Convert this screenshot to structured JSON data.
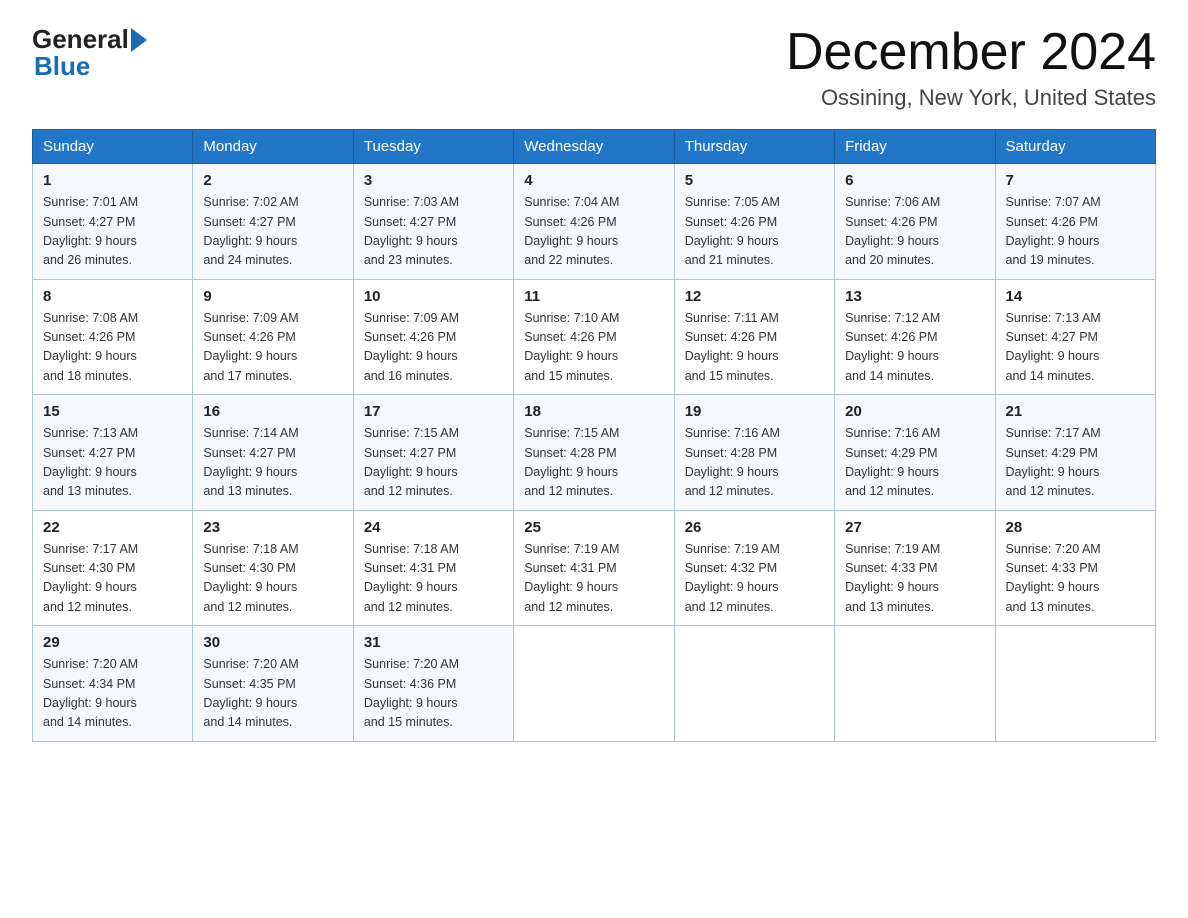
{
  "logo": {
    "general": "General",
    "blue": "Blue",
    "arrow": "▶"
  },
  "title": {
    "month": "December 2024",
    "location": "Ossining, New York, United States"
  },
  "days_of_week": [
    "Sunday",
    "Monday",
    "Tuesday",
    "Wednesday",
    "Thursday",
    "Friday",
    "Saturday"
  ],
  "weeks": [
    [
      {
        "day": "1",
        "sunrise": "7:01 AM",
        "sunset": "4:27 PM",
        "daylight": "9 hours and 26 minutes."
      },
      {
        "day": "2",
        "sunrise": "7:02 AM",
        "sunset": "4:27 PM",
        "daylight": "9 hours and 24 minutes."
      },
      {
        "day": "3",
        "sunrise": "7:03 AM",
        "sunset": "4:27 PM",
        "daylight": "9 hours and 23 minutes."
      },
      {
        "day": "4",
        "sunrise": "7:04 AM",
        "sunset": "4:26 PM",
        "daylight": "9 hours and 22 minutes."
      },
      {
        "day": "5",
        "sunrise": "7:05 AM",
        "sunset": "4:26 PM",
        "daylight": "9 hours and 21 minutes."
      },
      {
        "day": "6",
        "sunrise": "7:06 AM",
        "sunset": "4:26 PM",
        "daylight": "9 hours and 20 minutes."
      },
      {
        "day": "7",
        "sunrise": "7:07 AM",
        "sunset": "4:26 PM",
        "daylight": "9 hours and 19 minutes."
      }
    ],
    [
      {
        "day": "8",
        "sunrise": "7:08 AM",
        "sunset": "4:26 PM",
        "daylight": "9 hours and 18 minutes."
      },
      {
        "day": "9",
        "sunrise": "7:09 AM",
        "sunset": "4:26 PM",
        "daylight": "9 hours and 17 minutes."
      },
      {
        "day": "10",
        "sunrise": "7:09 AM",
        "sunset": "4:26 PM",
        "daylight": "9 hours and 16 minutes."
      },
      {
        "day": "11",
        "sunrise": "7:10 AM",
        "sunset": "4:26 PM",
        "daylight": "9 hours and 15 minutes."
      },
      {
        "day": "12",
        "sunrise": "7:11 AM",
        "sunset": "4:26 PM",
        "daylight": "9 hours and 15 minutes."
      },
      {
        "day": "13",
        "sunrise": "7:12 AM",
        "sunset": "4:26 PM",
        "daylight": "9 hours and 14 minutes."
      },
      {
        "day": "14",
        "sunrise": "7:13 AM",
        "sunset": "4:27 PM",
        "daylight": "9 hours and 14 minutes."
      }
    ],
    [
      {
        "day": "15",
        "sunrise": "7:13 AM",
        "sunset": "4:27 PM",
        "daylight": "9 hours and 13 minutes."
      },
      {
        "day": "16",
        "sunrise": "7:14 AM",
        "sunset": "4:27 PM",
        "daylight": "9 hours and 13 minutes."
      },
      {
        "day": "17",
        "sunrise": "7:15 AM",
        "sunset": "4:27 PM",
        "daylight": "9 hours and 12 minutes."
      },
      {
        "day": "18",
        "sunrise": "7:15 AM",
        "sunset": "4:28 PM",
        "daylight": "9 hours and 12 minutes."
      },
      {
        "day": "19",
        "sunrise": "7:16 AM",
        "sunset": "4:28 PM",
        "daylight": "9 hours and 12 minutes."
      },
      {
        "day": "20",
        "sunrise": "7:16 AM",
        "sunset": "4:29 PM",
        "daylight": "9 hours and 12 minutes."
      },
      {
        "day": "21",
        "sunrise": "7:17 AM",
        "sunset": "4:29 PM",
        "daylight": "9 hours and 12 minutes."
      }
    ],
    [
      {
        "day": "22",
        "sunrise": "7:17 AM",
        "sunset": "4:30 PM",
        "daylight": "9 hours and 12 minutes."
      },
      {
        "day": "23",
        "sunrise": "7:18 AM",
        "sunset": "4:30 PM",
        "daylight": "9 hours and 12 minutes."
      },
      {
        "day": "24",
        "sunrise": "7:18 AM",
        "sunset": "4:31 PM",
        "daylight": "9 hours and 12 minutes."
      },
      {
        "day": "25",
        "sunrise": "7:19 AM",
        "sunset": "4:31 PM",
        "daylight": "9 hours and 12 minutes."
      },
      {
        "day": "26",
        "sunrise": "7:19 AM",
        "sunset": "4:32 PM",
        "daylight": "9 hours and 12 minutes."
      },
      {
        "day": "27",
        "sunrise": "7:19 AM",
        "sunset": "4:33 PM",
        "daylight": "9 hours and 13 minutes."
      },
      {
        "day": "28",
        "sunrise": "7:20 AM",
        "sunset": "4:33 PM",
        "daylight": "9 hours and 13 minutes."
      }
    ],
    [
      {
        "day": "29",
        "sunrise": "7:20 AM",
        "sunset": "4:34 PM",
        "daylight": "9 hours and 14 minutes."
      },
      {
        "day": "30",
        "sunrise": "7:20 AM",
        "sunset": "4:35 PM",
        "daylight": "9 hours and 14 minutes."
      },
      {
        "day": "31",
        "sunrise": "7:20 AM",
        "sunset": "4:36 PM",
        "daylight": "9 hours and 15 minutes."
      },
      null,
      null,
      null,
      null
    ]
  ],
  "labels": {
    "sunrise": "Sunrise:",
    "sunset": "Sunset:",
    "daylight": "Daylight:"
  }
}
